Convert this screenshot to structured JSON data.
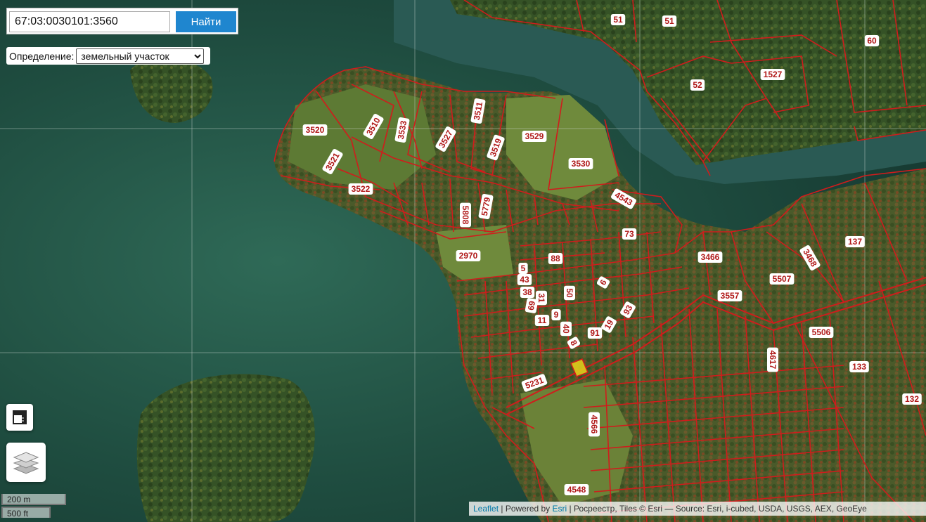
{
  "search": {
    "value": "67:03:0030101:3560",
    "button_label": "Найти"
  },
  "definition": {
    "label": "Определение:",
    "selected": "земельный участок"
  },
  "map": {
    "parcel_labels": [
      "51",
      "51",
      "60",
      "52",
      "1527",
      "3520",
      "3510",
      "3533",
      "3511",
      "3527",
      "3529",
      "3519",
      "3521",
      "3530",
      "3522",
      "4543",
      "5808",
      "5779",
      "73",
      "137",
      "3466",
      "3468",
      "2970",
      "88",
      "5",
      "43",
      "6",
      "5507",
      "50",
      "38",
      "31",
      "3557",
      "69",
      "93",
      "9",
      "11",
      "19",
      "40",
      "91",
      "8",
      "5506",
      "4617",
      "133",
      "5231",
      "132",
      "4566",
      "4548"
    ],
    "colors": {
      "parcel_line": "#d01c1c",
      "water": "#1f4a3e",
      "selected_parcel": "#e8d21a"
    }
  },
  "controls": {
    "ruler_icon": "ruler-icon",
    "layers_icon": "layers-icon"
  },
  "scale": {
    "metric": "200 m",
    "imperial": "500 ft"
  },
  "attribution": {
    "leaflet": "Leaflet",
    "sep1": " | Powered by ",
    "esri": "Esri",
    "rest": " | Росреестр, Tiles © Esri — Source: Esri, i-cubed, USDA, USGS, AEX, GeoEye"
  }
}
